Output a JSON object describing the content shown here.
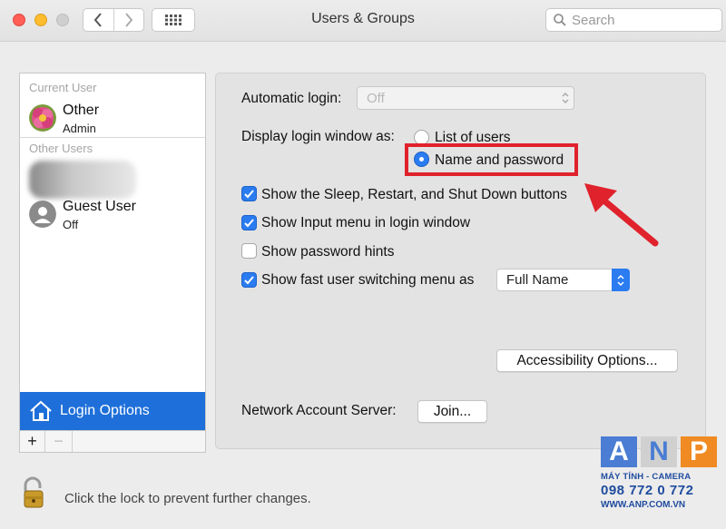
{
  "window": {
    "title": "Users & Groups"
  },
  "search": {
    "placeholder": "Search"
  },
  "sidebar": {
    "current_label": "Current User",
    "current_user": {
      "name": "Other",
      "role": "Admin"
    },
    "other_label": "Other Users",
    "guest_user": {
      "name": "Guest User",
      "status": "Off"
    },
    "login_options": "Login Options",
    "add": "+",
    "remove": "−"
  },
  "panel": {
    "auto_login_label": "Automatic login:",
    "auto_login_value": "Off",
    "display_label": "Display login window as:",
    "radio_list": "List of users",
    "radio_name": "Name and password",
    "selected_radio": "Name and password",
    "checks": [
      {
        "label": "Show the Sleep, Restart, and Shut Down buttons",
        "checked": true
      },
      {
        "label": "Show Input menu in login window",
        "checked": true
      },
      {
        "label": "Show password hints",
        "checked": false
      },
      {
        "label": "Show fast user switching menu as",
        "checked": true
      }
    ],
    "switching_value": "Full Name",
    "accessibility_button": "Accessibility Options...",
    "network_label": "Network Account Server:",
    "join_button": "Join..."
  },
  "footer": {
    "lock_message": "Click the lock to prevent further changes."
  },
  "watermark": {
    "letters": [
      "A",
      "N",
      "P"
    ],
    "tagline": "MÁY TÍNH - CAMERA",
    "phone": "098 772 0 772",
    "website": "WWW.ANP.COM.VN"
  },
  "colors": {
    "accent": "#1e6fd9",
    "highlight": "#e0222c",
    "wm_blue": "#4a7dd3",
    "wm_orange": "#f08a22"
  }
}
